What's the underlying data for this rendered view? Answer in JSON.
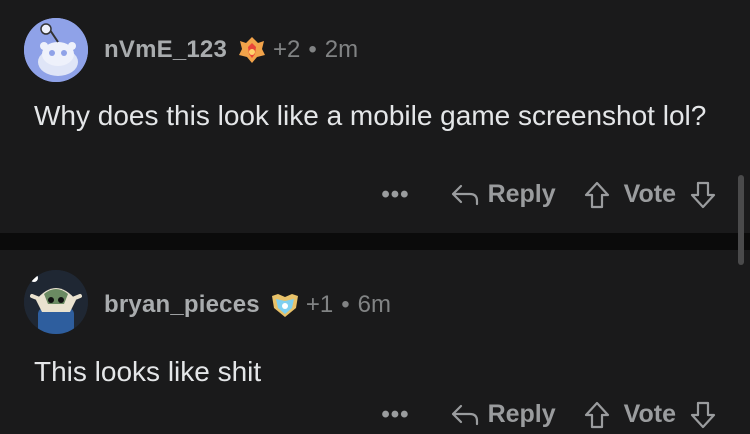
{
  "comments": [
    {
      "username": "nVmE_123",
      "karma": "+2",
      "time": "2m",
      "text": "Why does this look like a mobile game screenshot lol?",
      "more": "•••",
      "reply_label": "Reply",
      "vote_label": "Vote"
    },
    {
      "username": "bryan_pieces",
      "karma": "+1",
      "time": "6m",
      "text": "This looks like shit",
      "more": "•••",
      "reply_label": "Reply",
      "vote_label": "Vote"
    }
  ],
  "separator": "•",
  "icons": [
    "snoo-avatar-icon",
    "flame-badge-icon",
    "custom-avatar-icon",
    "shield-badge-icon",
    "reply-arrow-icon",
    "upvote-arrow-icon",
    "downvote-arrow-icon"
  ],
  "colors": {
    "background": "#1a1a1b",
    "text": "#e4e6e8",
    "meta": "#818384",
    "avatar_blue": "#8fa2e8"
  }
}
